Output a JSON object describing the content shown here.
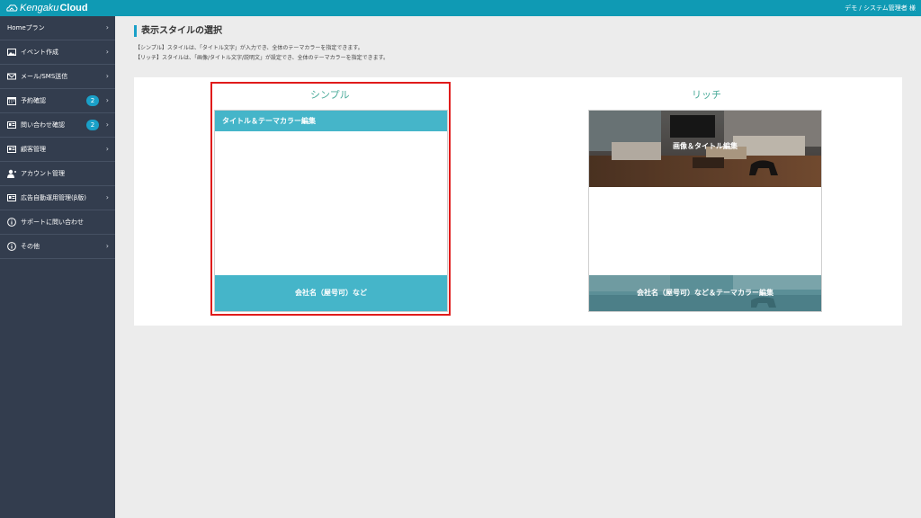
{
  "header": {
    "logo_prefix": "Kengaku",
    "logo_suffix": "Cloud",
    "user_label": "デモ / システム管理者 様"
  },
  "sidebar": {
    "items": [
      {
        "label": "Homeプラン",
        "icon": "none"
      },
      {
        "label": "イベント作成",
        "icon": "image-icon"
      },
      {
        "label": "メール/SMS送信",
        "icon": "mail-icon"
      },
      {
        "label": "予約確認",
        "icon": "calendar-icon",
        "badge": "2"
      },
      {
        "label": "問い合わせ確認",
        "icon": "id-card-icon",
        "badge": "2"
      },
      {
        "label": "顧客管理",
        "icon": "id-card-icon"
      },
      {
        "label": "アカウント管理",
        "icon": "user-icon"
      },
      {
        "label": "広告自動運用管理(β版)",
        "icon": "id-card-icon"
      },
      {
        "label": "サポートに問い合わせ",
        "icon": "info-icon"
      },
      {
        "label": "その他",
        "icon": "info-icon"
      }
    ],
    "chevron": "›"
  },
  "main": {
    "title": "表示スタイルの選択",
    "desc1": "【シンプル】スタイルは、「タイトル文字」が入力でき、全体のテーマカラーを指定できます。",
    "desc2": "【リッチ】スタイルは、「画像/タイトル文字/説明文」が設定でき、全体のテーマカラーを指定できます。",
    "simple": {
      "label": "シンプル",
      "top_text": "タイトル＆テーマカラー編集",
      "bottom_text": "会社名（屋号可）など"
    },
    "rich": {
      "label": "リッチ",
      "top_text": "画像＆タイトル編集",
      "bottom_text": "会社名（屋号可）など＆テーマカラー編集"
    }
  },
  "colors": {
    "topbar": "#0f9ab4",
    "sidebar": "#333d4e",
    "accent": "#45b5c9",
    "selected_border": "#e01b1b",
    "label_green": "#4cab9a"
  }
}
